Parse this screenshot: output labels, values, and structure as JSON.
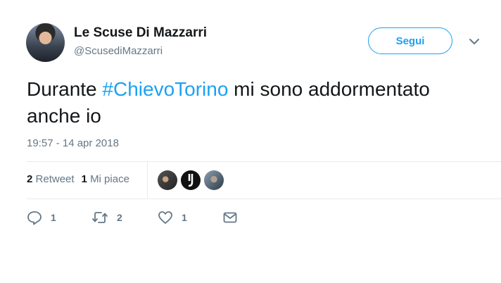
{
  "tweet": {
    "author_name": "Le Scuse Di Mazzarri",
    "author_handle": "@ScusediMazzarri",
    "follow_label": "Segui",
    "text_before": "Durante ",
    "hashtag": "#ChievoTorino",
    "text_after": " mi sono addormentato anche io",
    "timestamp": "19:57 - 14 apr 2018",
    "retweets_count": "2",
    "retweets_label": "Retweet",
    "likes_count": "1",
    "likes_label": "Mi piace",
    "liker_avatars": [
      "avatar-photo",
      "juventus-logo",
      "avatar-photo"
    ],
    "actions": {
      "reply_count": "1",
      "retweet_count": "2",
      "like_count": "1"
    }
  },
  "colors": {
    "accent": "#1da1f2",
    "text": "#14171a",
    "secondary": "#657786",
    "divider": "#e6ecf0"
  },
  "icons": [
    "chevron-down-icon",
    "reply-icon",
    "retweet-icon",
    "heart-icon",
    "mail-icon"
  ]
}
